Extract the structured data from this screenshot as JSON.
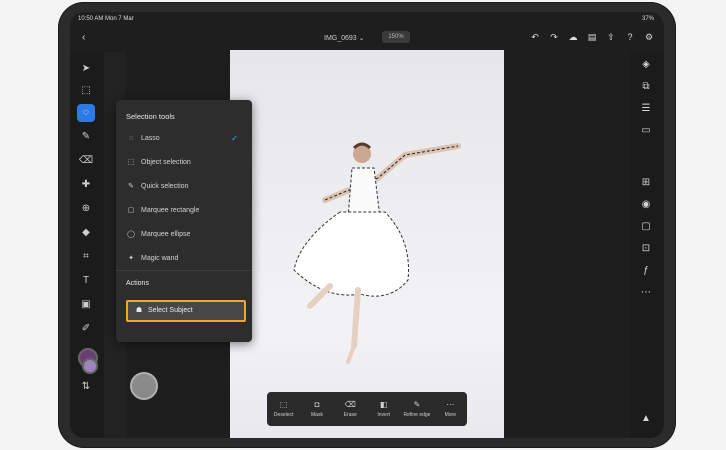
{
  "status_bar": {
    "time": "10:50 AM  Mon 7 Mar",
    "battery": "37%"
  },
  "topbar": {
    "back_icon": "chevron-left-icon",
    "doc_title": "IMG_0693 ⌄",
    "zoom": "150%",
    "icons": [
      "undo-icon",
      "redo-icon",
      "cloud-icon",
      "layers-share-icon",
      "share-icon",
      "help-icon",
      "settings-icon"
    ]
  },
  "tools": [
    "select-icon",
    "transform-icon",
    "lasso-icon",
    "brush-icon",
    "eraser-icon",
    "heal-icon",
    "clone-icon",
    "fill-icon",
    "crop-icon",
    "text-icon",
    "image-icon",
    "eyedropper-icon"
  ],
  "colors": {
    "accent": "#2c7be5",
    "highlight": "#f1a71e",
    "swatch_fg": "#6a3f73",
    "swatch_bg": "#9a86b8"
  },
  "selection_menu": {
    "title": "Selection tools",
    "items": [
      {
        "icon": "lasso-icon",
        "label": "Lasso",
        "checked": true
      },
      {
        "icon": "object-selection-icon",
        "label": "Object selection"
      },
      {
        "icon": "quick-selection-icon",
        "label": "Quick selection"
      },
      {
        "icon": "marquee-rectangle-icon",
        "label": "Marquee rectangle"
      },
      {
        "icon": "marquee-ellipse-icon",
        "label": "Marquee ellipse"
      },
      {
        "icon": "magic-wand-icon",
        "label": "Magic wand"
      }
    ],
    "actions_title": "Actions",
    "select_subject": "Select Subject"
  },
  "bottom_toolbar": [
    {
      "icon": "deselect-icon",
      "label": "Deselect"
    },
    {
      "icon": "mask-icon",
      "label": "Mask"
    },
    {
      "icon": "erase-icon",
      "label": "Erase"
    },
    {
      "icon": "invert-icon",
      "label": "Invert"
    },
    {
      "icon": "refine-edge-icon",
      "label": "Refine edge"
    },
    {
      "icon": "more-icon",
      "label": "More"
    }
  ]
}
